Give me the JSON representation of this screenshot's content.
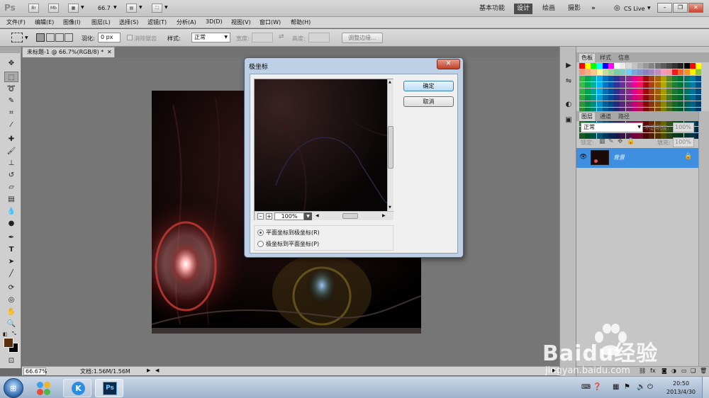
{
  "app": {
    "logo": "Ps",
    "bridge_label": "Br",
    "minibridge_label": "Mb",
    "zoom": "66.7",
    "workspaces": [
      "基本功能",
      "设计",
      "绘画",
      "摄影"
    ],
    "active_workspace": "设计",
    "more": "»",
    "cslive": "CS Live"
  },
  "menu": [
    "文件(F)",
    "编辑(E)",
    "图像(I)",
    "图层(L)",
    "选择(S)",
    "滤镜(T)",
    "分析(A)",
    "3D(D)",
    "视图(V)",
    "窗口(W)",
    "帮助(H)"
  ],
  "options": {
    "feather_label": "羽化:",
    "feather_value": "0 px",
    "antialias_label": "消除锯齿",
    "style_label": "样式:",
    "style_value": "正常",
    "width_label": "宽度:",
    "height_label": "高度:",
    "refine_edge": "调整边缘..."
  },
  "document": {
    "tab_title": "未标题-1 @ 66.7%(RGB/8) *",
    "status_zoom": "66.67%",
    "status_doc": "文档:1.56M/1.56M"
  },
  "panels": {
    "color_tabs": [
      "色板",
      "样式",
      "信息"
    ],
    "layers_tabs": [
      "图层",
      "通道",
      "路径"
    ],
    "blend_mode": "正常",
    "opacity_label": "不透明度:",
    "opacity_value": "100%",
    "lock_label": "锁定:",
    "fill_label": "填充:",
    "fill_value": "100%",
    "layer_name": "背景"
  },
  "dialog": {
    "title": "极坐标",
    "ok": "确定",
    "cancel": "取消",
    "preview_zoom": "100%",
    "option1": "平面坐标到极坐标(R)",
    "option2": "极坐标到平面坐标(P)",
    "selected_option": 1
  },
  "taskbar": {
    "time": "20:50",
    "date": "2013/4/30"
  },
  "watermark": {
    "brand": "Baidu经验",
    "url": "jingyan.baidu.com"
  }
}
